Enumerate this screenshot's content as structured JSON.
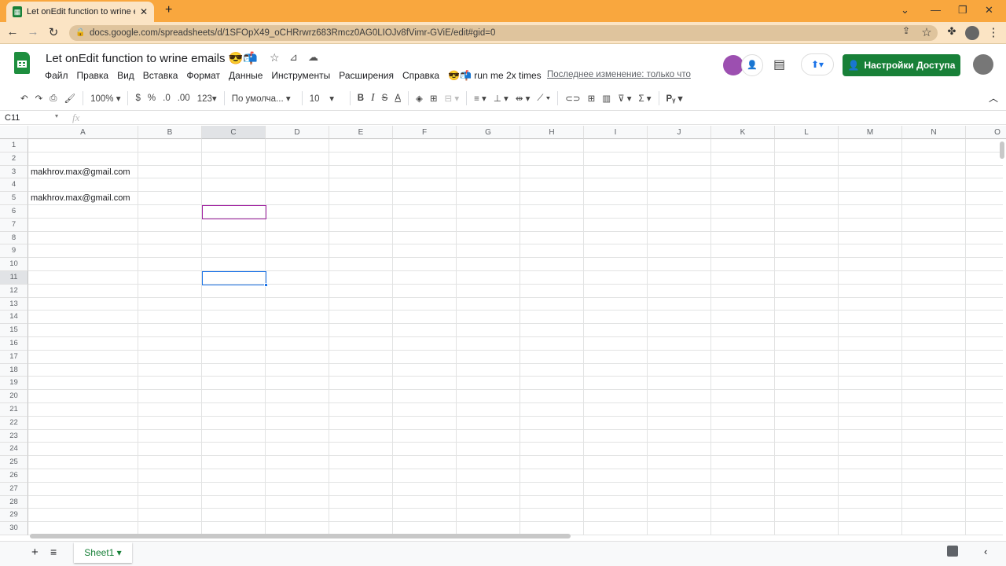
{
  "browser": {
    "tab_title": "Let onEdit function to wrine emails",
    "url": "docs.google.com/spreadsheets/d/1SFOpX49_oCHRrwrz683Rmcz0AG0LIOJv8fVimr-GViE/edit#gid=0"
  },
  "doc": {
    "title": "Let onEdit function to wrine emails 😎📬",
    "menus": [
      "Файл",
      "Правка",
      "Вид",
      "Вставка",
      "Формат",
      "Данные",
      "Инструменты",
      "Расширения",
      "Справка",
      "😎📬 run me 2x times"
    ],
    "last_edit": "Последнее изменение: только что",
    "share_label": "Настройки Доступа"
  },
  "toolbar": {
    "zoom": "100%",
    "currency": "$",
    "percent": "%",
    "dec_less": ".0",
    "dec_more": ".00",
    "format": "123▾",
    "font": "По умолча...",
    "font_size": "10"
  },
  "formula_bar": {
    "cell_ref": "C11",
    "fx": "fx",
    "value": ""
  },
  "grid": {
    "columns": [
      "A",
      "B",
      "C",
      "D",
      "E",
      "F",
      "G",
      "H",
      "I",
      "J",
      "K",
      "L",
      "M",
      "N",
      "O"
    ],
    "row_count": 30,
    "cells": [
      {
        "ref": "A3",
        "value": "makhrov.max@gmail.com"
      },
      {
        "ref": "A5",
        "value": "makhrov.max@gmail.com"
      }
    ],
    "selected": "C11",
    "collaborator_cell": "C6",
    "selection_color": "#1a73e8",
    "collaborator_color": "#a020a0"
  },
  "sheets": {
    "tabs": [
      "Sheet1"
    ]
  },
  "colors": {
    "tabbar": "#f9a73e",
    "share": "#188038"
  }
}
